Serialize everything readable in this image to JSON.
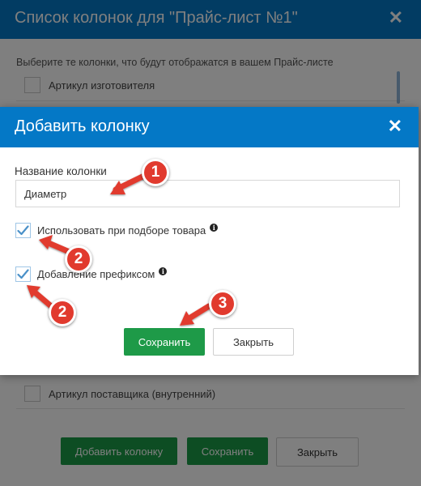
{
  "background_dialog": {
    "title": "Список колонок для \"Прайс-лист №1\"",
    "hint": "Выберите те колонки, что будут отображатся в вашем Прайс-листе",
    "items": [
      {
        "label": "Артикул изготовителя"
      },
      {
        "label": "Артикул поставщика (внутренний)"
      }
    ],
    "buttons": {
      "add_column": "Добавить колонку",
      "save": "Сохранить",
      "close": "Закрыть"
    }
  },
  "dialog": {
    "title": "Добавить колонку",
    "column_name_label": "Название колонки",
    "column_name_value": "Диаметр",
    "use_in_selection_label": "Использовать при подборе товара",
    "use_in_selection_checked": true,
    "add_prefix_label": "Добавление префиксом",
    "add_prefix_checked": true,
    "save_label": "Сохранить",
    "close_label": "Закрыть",
    "info_icon": "i"
  },
  "annotations": {
    "badge_1": "1",
    "badge_2a": "2",
    "badge_2b": "2",
    "badge_3": "3"
  },
  "colors": {
    "header_blue": "#0478c6",
    "save_green": "#1e9a48",
    "badge_red": "#e13a2e",
    "check_blue": "#4a90c8"
  }
}
